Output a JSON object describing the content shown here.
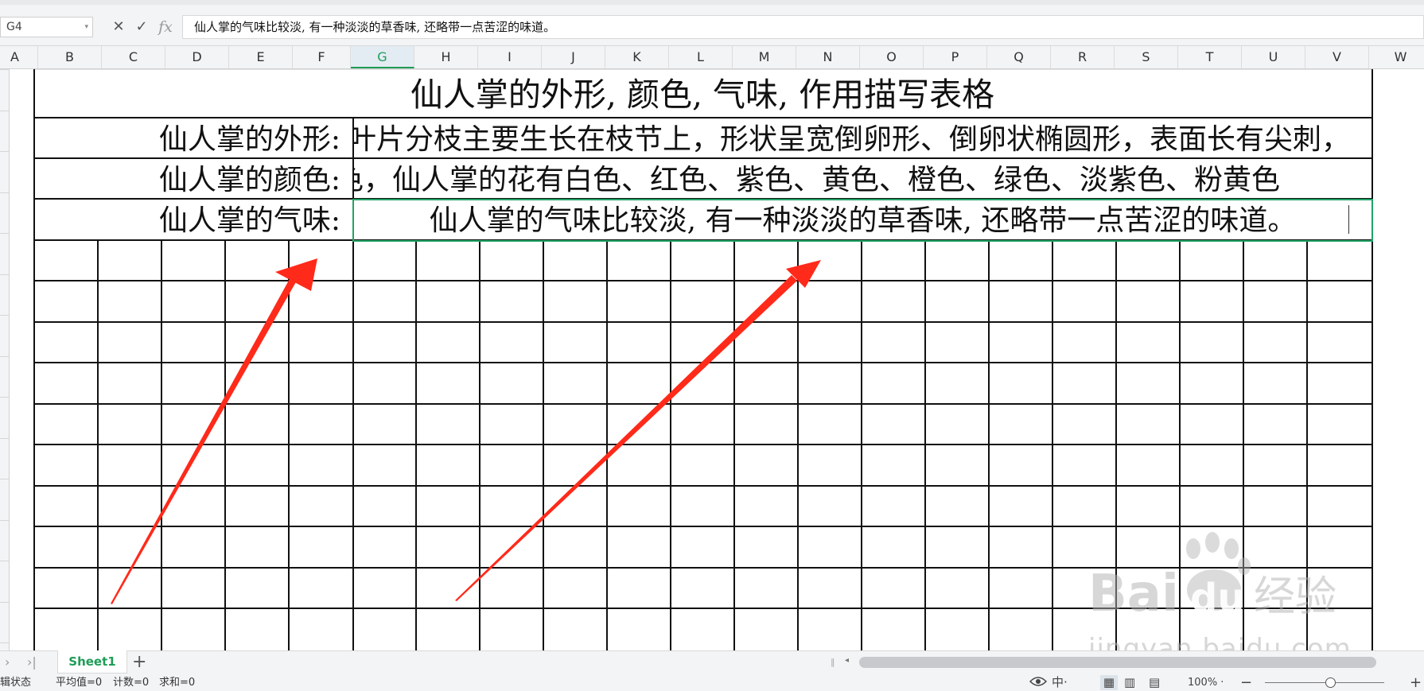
{
  "formula_bar": {
    "cell_ref": "G4",
    "cancel_symbol": "✕",
    "confirm_symbol": "✓",
    "fx_label": "fx",
    "value": "仙人掌的气味比较淡, 有一种淡淡的草香味, 还略带一点苦涩的味道。"
  },
  "columns": [
    "A",
    "B",
    "C",
    "D",
    "E",
    "F",
    "G",
    "H",
    "I",
    "J",
    "K",
    "L",
    "M",
    "N",
    "O",
    "P",
    "Q",
    "R",
    "S",
    "T",
    "U",
    "V",
    "W"
  ],
  "selected_column": "G",
  "sheet": {
    "title": "仙人掌的外形, 颜色, 气味, 作用描写表格",
    "rows": [
      {
        "label": "仙人掌的外形:",
        "description": "叶片分枝主要生长在枝节上，形状呈宽倒卵形、倒卵状椭圆形，表面长有尖刺，"
      },
      {
        "label": "仙人掌的颜色:",
        "description": "色，仙人掌的花有白色、红色、紫色、黄色、橙色、绿色、淡紫色、粉黄色"
      },
      {
        "label": "仙人掌的气味:",
        "description": "仙人掌的气味比较淡, 有一种淡淡的草香味, 还略带一点苦涩的味道。"
      }
    ]
  },
  "tabs": {
    "nav_prev": "›",
    "nav_last": "›|",
    "sheet_name": "Sheet1",
    "add": "+"
  },
  "status": {
    "mode": "辑状态",
    "average": "平均值=0",
    "count": "计数=0",
    "sum": "求和=0",
    "ime": "中·",
    "zoom": "100% ·",
    "zoom_minus": "−",
    "zoom_plus": "+"
  },
  "watermark": {
    "logo_text": "Bai",
    "logo_suffix": "du",
    "brand_cn": "经验",
    "url": "jingyan.baidu.com"
  },
  "colors": {
    "accent_green": "#1f9d57",
    "arrow_red": "#ff2a1a",
    "grid_line": "#111111"
  },
  "icons": {
    "cancel": "close-icon",
    "confirm": "check-icon",
    "formula": "fx-icon",
    "eye": "eye-icon",
    "normal_view": "grid-view-icon",
    "layout_view": "page-layout-icon",
    "break_view": "page-break-icon"
  }
}
